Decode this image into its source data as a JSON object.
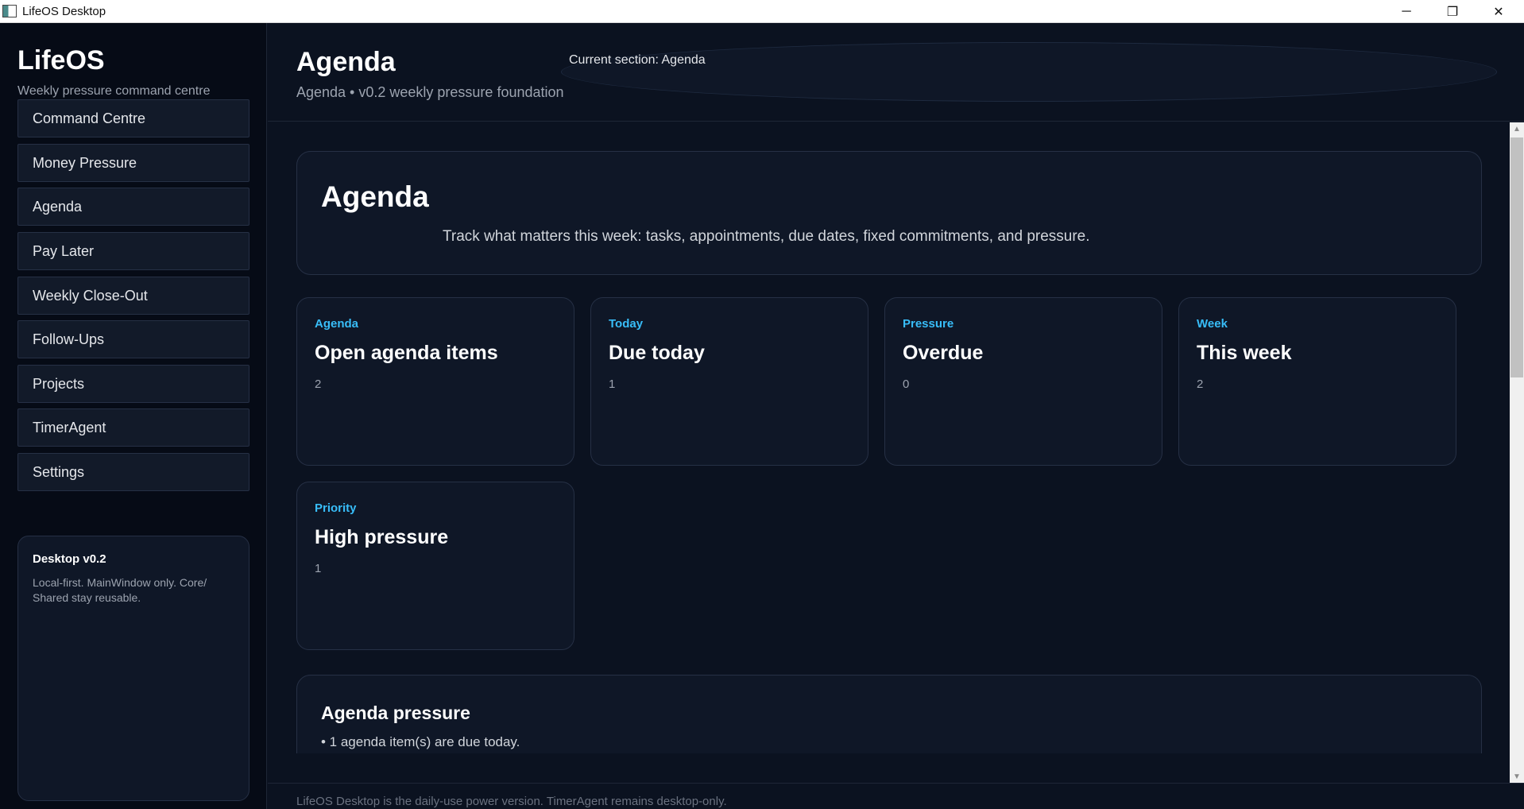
{
  "window": {
    "title": "LifeOS Desktop",
    "icon": "app-window-icon",
    "minimize_glyph": "─",
    "maximize_glyph": "❐",
    "close_glyph": "✕"
  },
  "sidebar": {
    "brand": "LifeOS",
    "tagline": "Weekly pressure command centre",
    "items": [
      {
        "label": "Command Centre"
      },
      {
        "label": "Money Pressure"
      },
      {
        "label": "Agenda"
      },
      {
        "label": "Pay Later"
      },
      {
        "label": "Weekly Close-Out"
      },
      {
        "label": "Follow-Ups"
      },
      {
        "label": "Projects"
      },
      {
        "label": "TimerAgent"
      },
      {
        "label": "Settings"
      }
    ],
    "version_card": {
      "title": "Desktop v0.2",
      "description": "Local-first. MainWindow only. Core/ Shared stay reusable."
    }
  },
  "header": {
    "title": "Agenda",
    "subtitle": "Agenda • v0.2 weekly pressure foundation",
    "current_section": "Current section: Agenda"
  },
  "hero": {
    "title": "Agenda",
    "description": "Track what matters this week: tasks, appointments, due dates, fixed commitments, and pressure."
  },
  "cards": [
    {
      "kicker": "Agenda",
      "title": "Open agenda items",
      "value": "2"
    },
    {
      "kicker": "Today",
      "title": "Due today",
      "value": "1"
    },
    {
      "kicker": "Pressure",
      "title": "Overdue",
      "value": "0"
    },
    {
      "kicker": "Week",
      "title": "This week",
      "value": "2"
    },
    {
      "kicker": "Priority",
      "title": "High pressure",
      "value": "1"
    }
  ],
  "pressure_panel": {
    "title": "Agenda pressure",
    "items": [
      "• 1 agenda item(s) are due today."
    ]
  },
  "scrollbar": {
    "up_glyph": "▲",
    "down_glyph": "▼"
  },
  "footer": {
    "text": "LifeOS Desktop is the daily-use power version. TimerAgent remains desktop-only."
  },
  "colors": {
    "background": "#0b1220",
    "sidebar": "#060b16",
    "card": "#0f1727",
    "accent": "#38bdf8",
    "border": "#263045"
  }
}
